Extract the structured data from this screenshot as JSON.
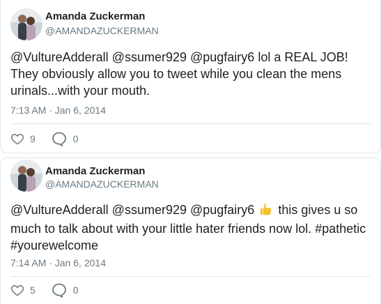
{
  "tweets": [
    {
      "author": {
        "name": "Amanda Zuckerman",
        "handle": "@AMANDAZUCKERMAN"
      },
      "text": "@VultureAdderall @ssumer929 @pugfairy6 lol a REAL JOB! They obviously allow you to tweet while you clean the mens urinals...with your mouth.",
      "timestamp": "7:13 AM · Jan 6, 2014",
      "likes": "9",
      "replies": "0"
    },
    {
      "author": {
        "name": "Amanda Zuckerman",
        "handle": "@AMANDAZUCKERMAN"
      },
      "text_before_emoji": "@VultureAdderall @ssumer929 @pugfairy6",
      "emoji": "thumbs-up-icon",
      "text_after_emoji": "this gives u so much to talk about with your little hater friends now lol. #pathetic #yourewelcome",
      "timestamp": "7:14 AM · Jan 6, 2014",
      "likes": "5",
      "replies": "0"
    }
  ],
  "icons": {
    "like": "heart-outline-icon",
    "reply": "speech-bubble-icon"
  },
  "colors": {
    "text": "#1c2022",
    "secondary": "#697882",
    "border": "#e1e8ed",
    "emoji": "#f6c02c"
  }
}
